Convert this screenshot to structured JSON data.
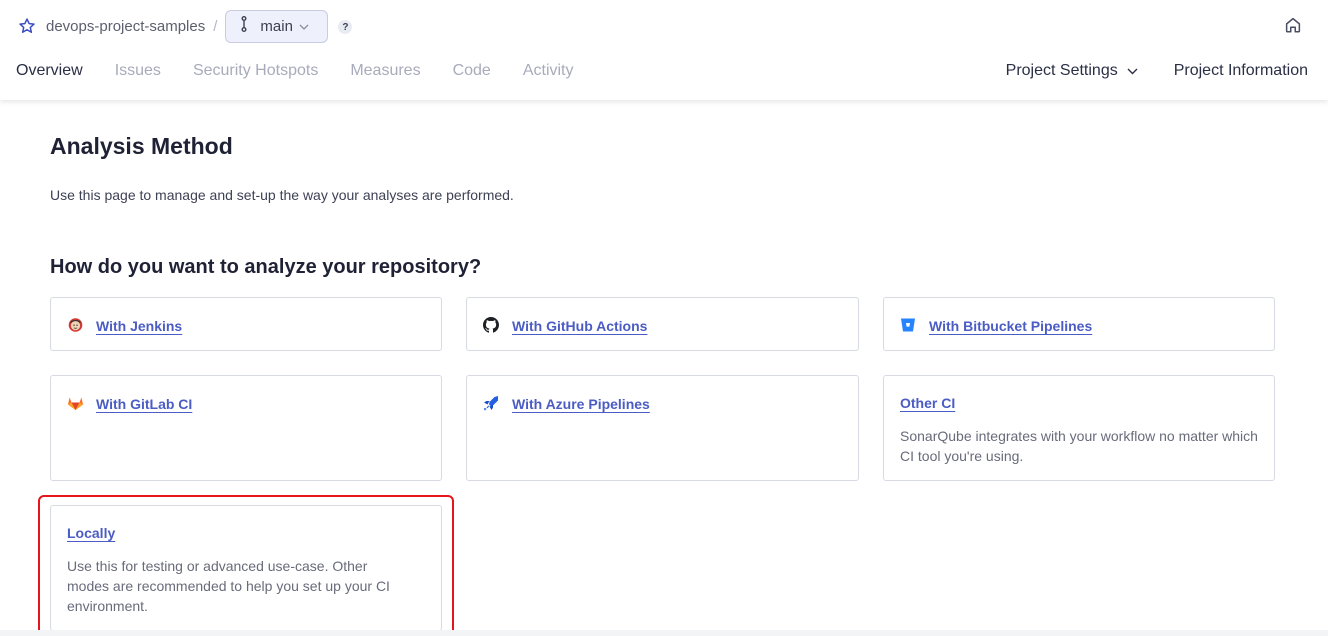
{
  "header": {
    "project_name": "devops-project-samples",
    "separator": "/",
    "branch": "main",
    "help": "?"
  },
  "nav": {
    "tabs": [
      {
        "label": "Overview",
        "active": true
      },
      {
        "label": "Issues",
        "active": false
      },
      {
        "label": "Security Hotspots",
        "active": false
      },
      {
        "label": "Measures",
        "active": false
      },
      {
        "label": "Code",
        "active": false
      },
      {
        "label": "Activity",
        "active": false
      }
    ],
    "project_settings": "Project Settings",
    "project_information": "Project Information"
  },
  "main": {
    "title": "Analysis Method",
    "description": "Use this page to manage and set-up the way your analyses are performed.",
    "question": "How do you want to analyze your repository?",
    "options": [
      {
        "label": "With Jenkins",
        "icon": "jenkins-icon"
      },
      {
        "label": "With GitHub Actions",
        "icon": "github-icon"
      },
      {
        "label": "With Bitbucket Pipelines",
        "icon": "bitbucket-icon"
      },
      {
        "label": "With GitLab CI",
        "icon": "gitlab-icon"
      },
      {
        "label": "With Azure Pipelines",
        "icon": "azure-pipelines-icon"
      },
      {
        "label": "Other CI",
        "description": "SonarQube integrates with your workflow no matter which CI tool you're using."
      },
      {
        "label": "Locally",
        "description": "Use this for testing or advanced use-case. Other modes are recommended to help you set up your CI environment."
      }
    ]
  },
  "colors": {
    "link": "#4b5cc4",
    "highlight": "#e5161b",
    "card_border": "#d8dae3"
  }
}
